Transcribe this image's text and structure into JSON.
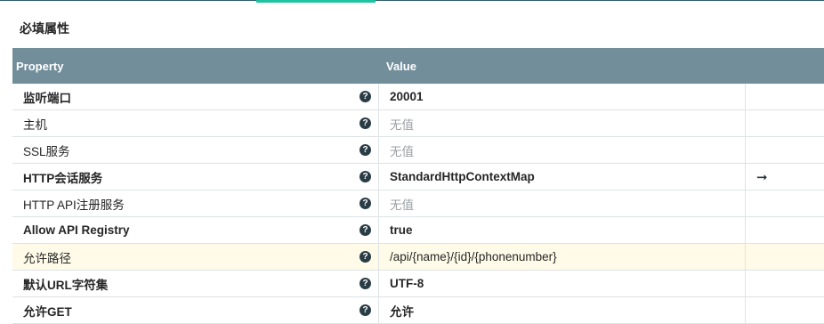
{
  "section_title": "必填属性",
  "headers": {
    "property": "Property",
    "value": "Value"
  },
  "rows": [
    {
      "name": "监听端口",
      "name_bold": true,
      "value": "20001",
      "value_bold": true,
      "placeholder": false,
      "highlight": false,
      "action": ""
    },
    {
      "name": "主机",
      "name_bold": false,
      "value": "无值",
      "value_bold": false,
      "placeholder": true,
      "highlight": false,
      "action": ""
    },
    {
      "name": "SSL服务",
      "name_bold": false,
      "value": "无值",
      "value_bold": false,
      "placeholder": true,
      "highlight": false,
      "action": ""
    },
    {
      "name": "HTTP会话服务",
      "name_bold": true,
      "value": "StandardHttpContextMap",
      "value_bold": true,
      "placeholder": false,
      "highlight": false,
      "action": "arrow-right-icon"
    },
    {
      "name": "HTTP API注册服务",
      "name_bold": false,
      "value": "无值",
      "value_bold": false,
      "placeholder": true,
      "highlight": false,
      "action": ""
    },
    {
      "name": "Allow API Registry",
      "name_bold": true,
      "value": "true",
      "value_bold": true,
      "placeholder": false,
      "highlight": false,
      "action": ""
    },
    {
      "name": "允许路径",
      "name_bold": false,
      "value": "/api/{name}/{id}/{phonenumber}",
      "value_bold": false,
      "placeholder": false,
      "highlight": true,
      "action": ""
    },
    {
      "name": "默认URL字符集",
      "name_bold": true,
      "value": "UTF-8",
      "value_bold": true,
      "placeholder": false,
      "highlight": false,
      "action": ""
    },
    {
      "name": "允许GET",
      "name_bold": true,
      "value": "允许",
      "value_bold": true,
      "placeholder": false,
      "highlight": false,
      "action": ""
    }
  ],
  "icons": {
    "help": "help-circle-icon",
    "help_glyph": "?",
    "arrow": "arrow-right-icon",
    "arrow_glyph": "➞"
  },
  "colors": {
    "header_bg": "#728e9b",
    "accent_tab": "#20c3a0",
    "highlight_row": "#fffbe8",
    "placeholder_text": "#9aa0a3"
  }
}
